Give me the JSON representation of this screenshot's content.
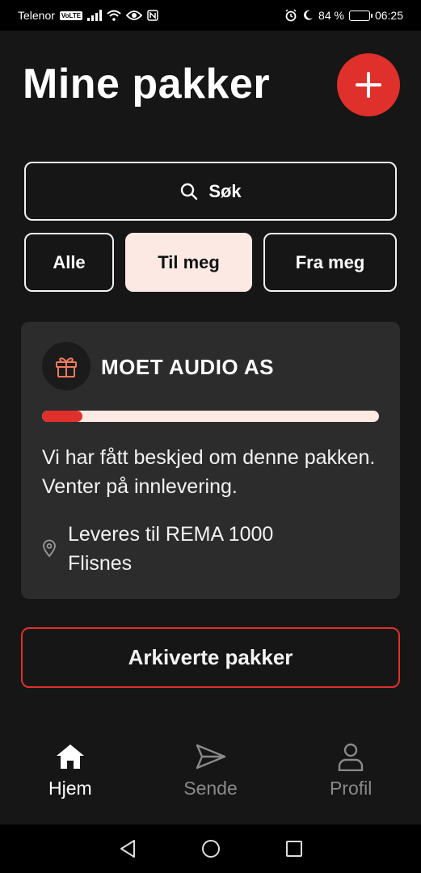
{
  "status_bar": {
    "carrier": "Telenor",
    "volte": "VoLTE",
    "battery": "84 %",
    "time": "06:25",
    "battery_level": 0.84
  },
  "header": {
    "title": "Mine pakker",
    "add_icon": "plus-icon"
  },
  "search": {
    "label": "Søk",
    "icon": "search-icon"
  },
  "filters": {
    "items": [
      {
        "label": "Alle",
        "active": false
      },
      {
        "label": "Til meg",
        "active": true
      },
      {
        "label": "Fra meg",
        "active": false
      }
    ]
  },
  "package": {
    "icon": "gift-icon",
    "sender": "MOET AUDIO AS",
    "progress": 0.12,
    "status": "Vi har fått beskjed om denne pakken. Venter på innlevering.",
    "location_icon": "location-pin-icon",
    "location": "Leveres til REMA 1000 Flisnes"
  },
  "archive": {
    "label": "Arkiverte pakker"
  },
  "bottom_nav": {
    "items": [
      {
        "label": "Hjem",
        "icon": "home-icon",
        "active": true
      },
      {
        "label": "Sende",
        "icon": "send-icon",
        "active": false
      },
      {
        "label": "Profil",
        "icon": "profile-icon",
        "active": false
      }
    ]
  },
  "colors": {
    "accent": "#e0302b",
    "active_filter_bg": "#fde9e4",
    "card_bg": "#2c2c2c",
    "background": "#161616"
  }
}
